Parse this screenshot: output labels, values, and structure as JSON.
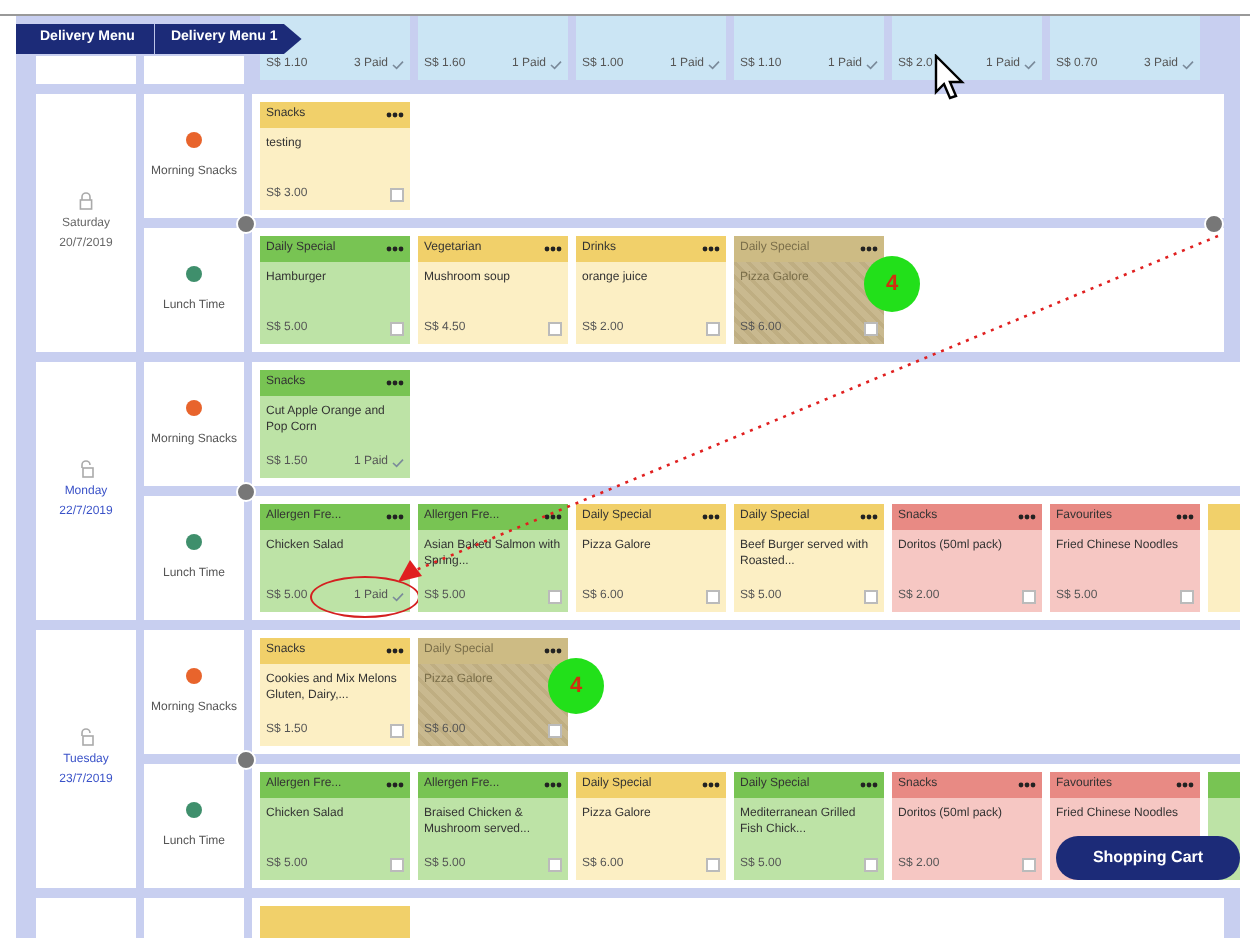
{
  "breadcrumb": [
    {
      "label": "Delivery Menu"
    },
    {
      "label": "Delivery Menu 1"
    }
  ],
  "top_strip_cards": [
    {
      "price": "S$ 1.10",
      "paid": "3 Paid",
      "checked": true
    },
    {
      "price": "S$ 1.60",
      "paid": "1 Paid",
      "checked": true
    },
    {
      "price": "S$ 1.00",
      "paid": "1 Paid",
      "checked": true
    },
    {
      "price": "S$ 1.10",
      "paid": "1 Paid",
      "checked": true
    },
    {
      "price": "S$ 2.0",
      "paid": "1 Paid",
      "checked": true
    },
    {
      "price": "S$ 0.70",
      "paid": "3 Paid",
      "checked": true
    }
  ],
  "days": [
    {
      "day": "Saturday",
      "date": "20/7/2019",
      "active": false,
      "meals": [
        {
          "name": "Morning Snacks",
          "color": "#e8642c",
          "items": [
            {
              "kind": "yellow",
              "category": "Snacks",
              "name": "testing",
              "price": "S$ 3.00",
              "checked": false
            }
          ]
        },
        {
          "name": "Lunch Time",
          "color": "#3f8f6c",
          "items": [
            {
              "kind": "green",
              "category": "Daily Special",
              "name": "Hamburger",
              "price": "S$ 5.00",
              "checked": false
            },
            {
              "kind": "yellow",
              "category": "Vegetarian",
              "name": "Mushroom soup",
              "price": "S$ 4.50",
              "checked": false
            },
            {
              "kind": "yellow",
              "category": "Drinks",
              "name": "orange juice",
              "price": "S$ 2.00",
              "checked": false
            },
            {
              "kind": "unavailable",
              "category": "Daily Special",
              "name": "Pizza Galore",
              "price": "S$ 6.00",
              "checked": false,
              "badge": "4"
            }
          ]
        }
      ]
    },
    {
      "day": "Monday",
      "date": "22/7/2019",
      "active": true,
      "meals": [
        {
          "name": "Morning Snacks",
          "color": "#e8642c",
          "items": [
            {
              "kind": "green",
              "category": "Snacks",
              "name": "Cut Apple Orange and Pop Corn",
              "price": "S$ 1.50",
              "paid": "1 Paid",
              "checked": true
            }
          ]
        },
        {
          "name": "Lunch Time",
          "color": "#3f8f6c",
          "items": [
            {
              "kind": "green",
              "category": "Allergen Fre...",
              "name": "Chicken Salad",
              "price": "S$ 5.00",
              "paid": "1 Paid",
              "checked": true,
              "circled": true
            },
            {
              "kind": "green",
              "category": "Allergen Fre...",
              "name": "Asian Baked Salmon with Spring...",
              "price": "S$ 5.00",
              "checked": false
            },
            {
              "kind": "yellow",
              "category": "Daily Special",
              "name": "Pizza Galore",
              "price": "S$ 6.00",
              "checked": false
            },
            {
              "kind": "yellow",
              "category": "Daily Special",
              "name": "Beef Burger served with Roasted...",
              "price": "S$ 5.00",
              "checked": false
            },
            {
              "kind": "red",
              "category": "Snacks",
              "name": "Doritos (50ml pack)",
              "price": "S$ 2.00",
              "checked": false
            },
            {
              "kind": "red",
              "category": "Favourites",
              "name": "Fried Chinese Noodles",
              "price": "S$ 5.00",
              "checked": false
            },
            {
              "kind": "stub-yellow"
            }
          ]
        }
      ]
    },
    {
      "day": "Tuesday",
      "date": "23/7/2019",
      "active": true,
      "meals": [
        {
          "name": "Morning Snacks",
          "color": "#e8642c",
          "items": [
            {
              "kind": "yellow",
              "category": "Snacks",
              "name": "Cookies and Mix Melons Gluten, Dairy,...",
              "price": "S$ 1.50",
              "checked": false
            },
            {
              "kind": "unavailable",
              "category": "Daily Special",
              "name": "Pizza Galore",
              "price": "S$ 6.00",
              "checked": false,
              "badge": "4"
            }
          ]
        },
        {
          "name": "Lunch Time",
          "color": "#3f8f6c",
          "items": [
            {
              "kind": "green",
              "category": "Allergen Fre...",
              "name": "Chicken Salad",
              "price": "S$ 5.00",
              "checked": false
            },
            {
              "kind": "green",
              "category": "Allergen Fre...",
              "name": "Braised Chicken & Mushroom served...",
              "price": "S$ 5.00",
              "checked": false
            },
            {
              "kind": "yellow",
              "category": "Daily Special",
              "name": "Pizza Galore",
              "price": "S$ 6.00",
              "checked": false
            },
            {
              "kind": "green",
              "category": "Daily Special",
              "name": "Mediterranean Grilled Fish Chick...",
              "price": "S$ 5.00",
              "checked": false
            },
            {
              "kind": "red",
              "category": "Snacks",
              "name": "Doritos (50ml pack)",
              "price": "S$ 2.00",
              "checked": false
            },
            {
              "kind": "red",
              "category": "Favourites",
              "name": "Fried Chinese Noodles"
            },
            {
              "kind": "stub-green"
            }
          ]
        }
      ]
    }
  ],
  "shopping_cart": "Shopping Cart"
}
